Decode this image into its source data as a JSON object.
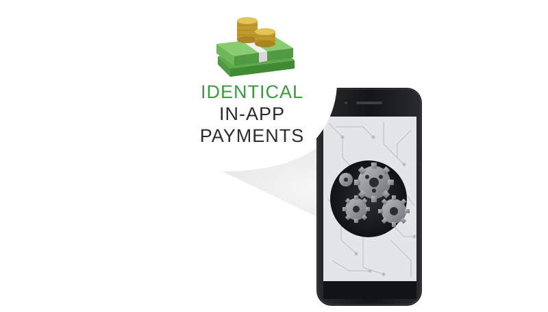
{
  "caption": {
    "line1": "IDENTICAL",
    "line2": "IN-APP",
    "line3": "PAYMENTS"
  },
  "colors": {
    "background": "#ffffff",
    "accent_green": "#3a9a3f",
    "text_dark": "#2b2b2b",
    "phone_body": "#1c1d1f",
    "phone_screen": "#e4e6e8",
    "beam": "#eeeeee",
    "gear": "#8c8f93",
    "money_green": "#6fb85a",
    "coin_gold": "#c9a233"
  },
  "icons": {
    "money": "money-stack-with-coins-icon",
    "gears": "gears-icon",
    "phone": "smartphone-icon"
  }
}
